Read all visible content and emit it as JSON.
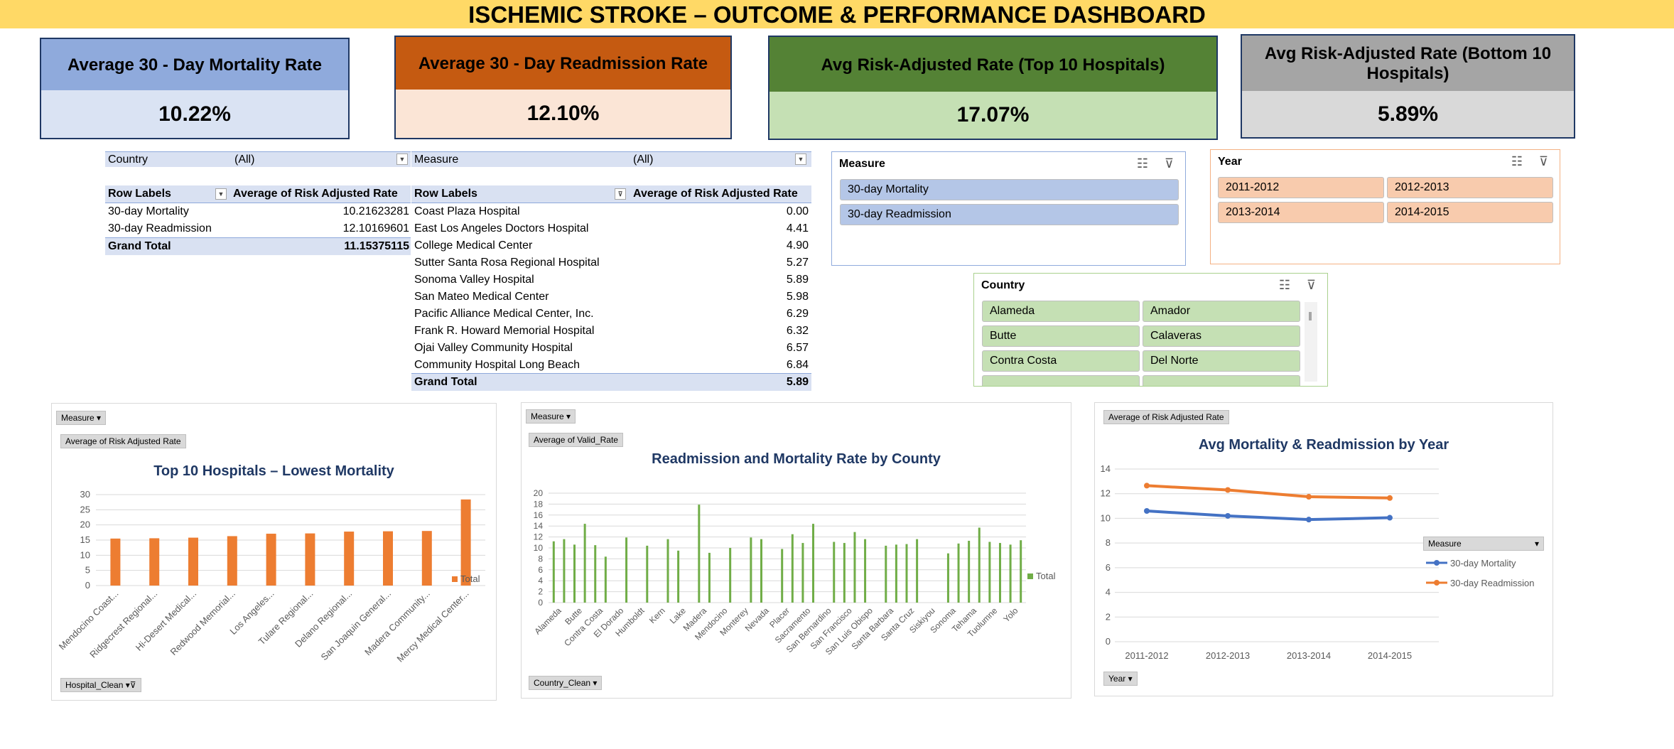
{
  "banner": {
    "title": "ISCHEMIC STROKE – OUTCOME & PERFORMANCE DASHBOARD"
  },
  "kpis": [
    {
      "label": "Average 30 - Day Mortality Rate",
      "value": "10.22%",
      "head_bg": "#8faadc",
      "val_bg": "#dae3f3"
    },
    {
      "label": "Average 30 - Day Readmission Rate",
      "value": "12.10%",
      "head_bg": "#c55a11",
      "val_bg": "#fbe5d6"
    },
    {
      "label": "Avg Risk-Adjusted Rate (Top 10 Hospitals)",
      "value": "17.07%",
      "head_bg": "#548235",
      "val_bg": "#c5e0b4"
    },
    {
      "label": "Avg Risk-Adjusted Rate (Bottom 10 Hospitals)",
      "value": "5.89%",
      "head_bg": "#a5a5a5",
      "val_bg": "#d9d9d9"
    }
  ],
  "pivot1": {
    "filter_label": "Country",
    "filter_value": "(All)",
    "col1": "Row Labels",
    "col2": "Average of Risk Adjusted Rate",
    "rows": [
      {
        "label": "30-day Mortality",
        "value": "10.21623281"
      },
      {
        "label": "30-day Readmission",
        "value": "12.10169601"
      }
    ],
    "total_label": "Grand Total",
    "total_value": "11.15375115"
  },
  "pivot2": {
    "filter_label": "Measure",
    "filter_value": "(All)",
    "col1": "Row Labels",
    "col2": "Average of Risk Adjusted Rate",
    "rows": [
      {
        "label": "Coast Plaza Hospital",
        "value": "0.00"
      },
      {
        "label": "East Los Angeles Doctors Hospital",
        "value": "4.41"
      },
      {
        "label": "College Medical Center",
        "value": "4.90"
      },
      {
        "label": "Sutter Santa Rosa Regional Hospital",
        "value": "5.27"
      },
      {
        "label": "Sonoma Valley Hospital",
        "value": "5.89"
      },
      {
        "label": "San Mateo Medical Center",
        "value": "5.98"
      },
      {
        "label": "Pacific Alliance Medical Center, Inc.",
        "value": "6.29"
      },
      {
        "label": "Frank R. Howard Memorial Hospital",
        "value": "6.32"
      },
      {
        "label": "Ojai Valley Community Hospital",
        "value": "6.57"
      },
      {
        "label": "Community Hospital Long Beach",
        "value": "6.84"
      }
    ],
    "total_label": "Grand Total",
    "total_value": "5.89"
  },
  "slicer_measure": {
    "title": "Measure",
    "items": [
      "30-day Mortality",
      "30-day Readmission"
    ],
    "btn_color": "#b4c6e7",
    "border_color": "#8faadc"
  },
  "slicer_year": {
    "title": "Year",
    "items": [
      "2011-2012",
      "2012-2013",
      "2013-2014",
      "2014-2015"
    ],
    "btn_color": "#f8cbad",
    "border_color": "#f4b183"
  },
  "slicer_country": {
    "title": "Country",
    "items": [
      "Alameda",
      "Amador",
      "Butte",
      "Calaveras",
      "Contra Costa",
      "Del Norte"
    ],
    "btn_color": "#c5e0b4",
    "border_color": "#a9d18e"
  },
  "chart1": {
    "filter_button": "Measure",
    "value_button": "Average of Risk Adjusted Rate",
    "axis_button": "Hospital_Clean",
    "legend": "Total",
    "chart_data": {
      "type": "bar",
      "title": "Top 10 Hospitals – Lowest Mortality",
      "categories": [
        "Mendocino Coast...",
        "Ridgecrest Regional...",
        "Hi-Desert Medical...",
        "Redwood Memorial...",
        "Los Angeles...",
        "Tulare Regional...",
        "Delano Regional...",
        "San Joaquin General...",
        "Madera Community...",
        "Mercy Medical Center..."
      ],
      "values": [
        15.5,
        15.6,
        15.8,
        16.3,
        17.1,
        17.2,
        17.8,
        17.9,
        18.0,
        28.4
      ],
      "ylim": [
        0,
        30
      ],
      "yticks": [
        0,
        5,
        10,
        15,
        20,
        25,
        30
      ],
      "color": "#ed7d31",
      "grid": true,
      "legend_position": "right"
    }
  },
  "chart2": {
    "filter_button": "Measure",
    "value_button": "Average of Valid_Rate",
    "axis_button": "Country_Clean",
    "legend": "Total",
    "chart_data": {
      "type": "bar",
      "title": "Readmission and Mortality Rate by County",
      "tick_labels": [
        "Alameda",
        "Butte",
        "Contra Costa",
        "El Dorado",
        "Humboldt",
        "Kern",
        "Lake",
        "Madera",
        "Mendocino",
        "Monterey",
        "Nevada",
        "Placer",
        "Sacramento",
        "San Bernardino",
        "San Francisco",
        "San Luis Obispo",
        "Santa Barbara",
        "Santa Cruz",
        "Siskiyou",
        "Sonoma",
        "Tehama",
        "Tuolumne",
        "Yolo"
      ],
      "values": [
        11.2,
        11.6,
        10.6,
        14.4,
        10.5,
        8.4,
        null,
        11.9,
        null,
        10.4,
        null,
        11.6,
        9.5,
        null,
        17.9,
        9.1,
        null,
        10.0,
        null,
        11.9,
        11.6,
        null,
        9.8,
        12.5,
        10.9,
        14.4,
        null,
        11.1,
        10.9,
        12.9,
        11.6,
        null,
        10.4,
        10.6,
        10.7,
        11.6,
        null,
        null,
        9.0,
        10.8,
        11.3,
        13.7,
        11.1,
        10.9,
        10.6,
        11.4
      ],
      "ylim": [
        0,
        20
      ],
      "yticks": [
        0,
        2,
        4,
        6,
        8,
        10,
        12,
        14,
        16,
        18,
        20
      ],
      "color": "#70ad47",
      "grid": true,
      "legend_position": "right"
    }
  },
  "chart3": {
    "value_button": "Average of Risk Adjusted Rate",
    "axis_button": "Year",
    "legend_title": "Measure",
    "chart_data": {
      "type": "line",
      "title": "Avg Mortality & Readmission by Year",
      "categories": [
        "2011-2012",
        "2012-2013",
        "2013-2014",
        "2014-2015"
      ],
      "series": [
        {
          "name": "30-day Mortality",
          "values": [
            10.6,
            10.2,
            9.9,
            10.05
          ],
          "color": "#4472c4"
        },
        {
          "name": "30-day Readmission",
          "values": [
            12.65,
            12.3,
            11.75,
            11.65
          ],
          "color": "#ed7d31"
        }
      ],
      "ylim": [
        0,
        14
      ],
      "yticks": [
        0,
        2,
        4,
        6,
        8,
        10,
        12,
        14
      ],
      "grid": true,
      "legend_position": "right"
    }
  }
}
